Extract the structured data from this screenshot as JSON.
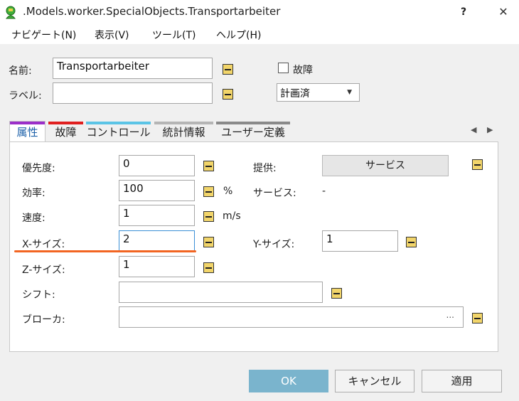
{
  "window": {
    "title": ".Models.worker.SpecialObjects.Transportarbeiter",
    "help_label": "?",
    "close_label": "✕"
  },
  "menu": [
    "ナビゲート(N)",
    "表示(V)",
    "ツール(T)",
    "ヘルプ(H)"
  ],
  "header": {
    "name_label": "名前:",
    "name_value": "Transportarbeiter",
    "label_label": "ラベル:",
    "label_value": "",
    "failure_label": "故障",
    "failure_checked": false,
    "status_value": "計画済"
  },
  "tabs": [
    {
      "label": "属性",
      "color": "#9b2fc9",
      "active": true
    },
    {
      "label": "故障",
      "color": "#e01f1f",
      "active": false
    },
    {
      "label": "コントロール",
      "color": "#5bc4e6",
      "active": false
    },
    {
      "label": "統計情報",
      "color": "#b5b5b5",
      "active": false
    },
    {
      "label": "ユーザー定義",
      "color": "#8a8a8a",
      "active": false
    }
  ],
  "attributes": {
    "priority_label": "優先度:",
    "priority_value": "0",
    "efficiency_label": "効率:",
    "efficiency_value": "100",
    "efficiency_unit": "%",
    "speed_label": "速度:",
    "speed_value": "1",
    "speed_unit": "m/s",
    "xsize_label": "X-サイズ:",
    "xsize_value": "2",
    "ysize_label": "Y-サイズ:",
    "ysize_value": "1",
    "zsize_label": "Z-サイズ:",
    "zsize_value": "1",
    "shift_label": "シフト:",
    "shift_value": "",
    "broker_label": "ブローカ:",
    "broker_value": "",
    "broker_ellipsis": "...",
    "provide_label": "提供:",
    "provide_button": "サービス",
    "services_label": "サービス:",
    "services_value": "-"
  },
  "buttons": {
    "ok": "OK",
    "cancel": "キャンセル",
    "apply": "適用"
  },
  "colors": {
    "accent_ok": "#7ab4cd",
    "highlight_underline": "#f26522",
    "minus_icon": "#f2d56a"
  }
}
